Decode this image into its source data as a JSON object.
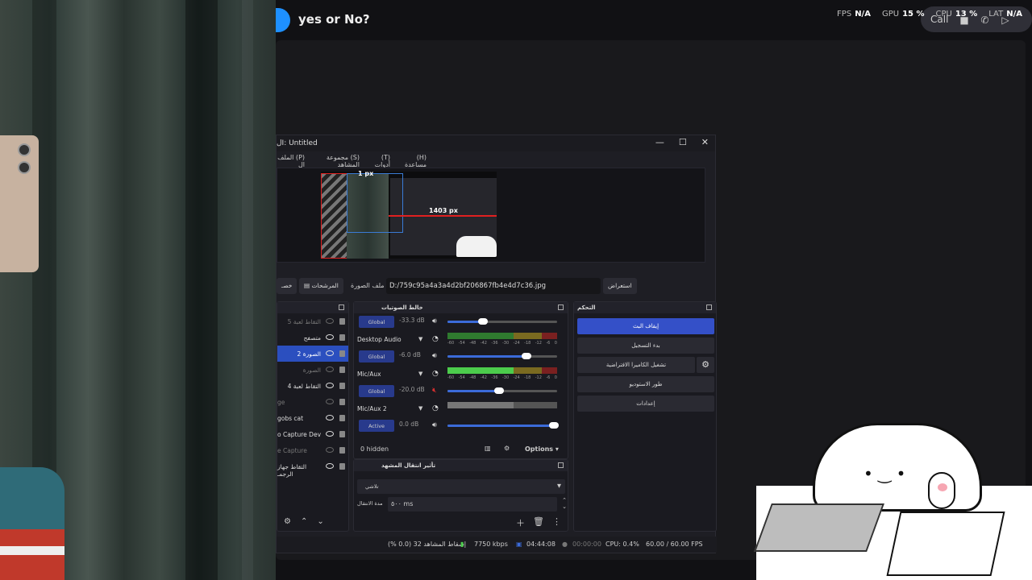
{
  "call": {
    "title": "yes or No?",
    "stats": [
      {
        "label": "FPS",
        "value": "N/A"
      },
      {
        "label": "GPU",
        "value": "15 %"
      },
      {
        "label": "CPU",
        "value": "13 %"
      },
      {
        "label": "LAT",
        "value": "N/A"
      }
    ],
    "call_label": "Call"
  },
  "obs": {
    "window_title": "لI: Untitled",
    "menu": [
      "(H) مساعدة",
      "(T) أدوات",
      "(S) مجموعة المشاهد",
      "(P) الملف ال"
    ],
    "preview": {
      "top_label": "1 px",
      "right_label": "1403 px"
    },
    "props": {
      "partial_btn": "خصـ",
      "filters_btn": "المرشحات",
      "image_file_label": "ملف الصورة",
      "path": "D:/759c95a4a3a4d2bf206867fb4e4d7c36.jpg",
      "browse_btn": "استعراض"
    },
    "sources": {
      "items": [
        {
          "name": "التقاط لعبة 5",
          "dim": true,
          "selected": false
        },
        {
          "name": "متصفح",
          "dim": false,
          "selected": false
        },
        {
          "name": "الصورة 2",
          "dim": false,
          "selected": true
        },
        {
          "name": "الصورة",
          "dim": true,
          "selected": false
        },
        {
          "name": "التقاط لعبة 4",
          "dim": false,
          "selected": false
        },
        {
          "name": "ge",
          "dim": true,
          "selected": false
        },
        {
          "name": "gobs cat",
          "dim": false,
          "selected": false
        },
        {
          "name": "o Capture Dev",
          "dim": false,
          "selected": false
        },
        {
          "name": "e Capture",
          "dim": true,
          "selected": false
        },
        {
          "name": "التقاط جهاز الرجمـ",
          "dim": false,
          "selected": false
        }
      ]
    },
    "mixer": {
      "title": "خالط الصوتيات",
      "channels": [
        {
          "mode": "Global",
          "db": "-33.3 dB",
          "name": "Desktop Audio",
          "level": 0.35,
          "muted": false
        },
        {
          "mode": "Global",
          "db": "-6.0 dB",
          "name": "Mic/Aux",
          "level": 0.75,
          "muted": false
        },
        {
          "mode": "Global",
          "db": "-20.0 dB",
          "name": "Mic/Aux 2",
          "level": 0.5,
          "muted": true
        },
        {
          "mode": "Active",
          "db": "0.0 dB",
          "name": "",
          "level": 1.0,
          "muted": false
        }
      ],
      "ticks": [
        "-60",
        "-54",
        "-48",
        "-42",
        "-36",
        "-30",
        "-24",
        "-18",
        "-12",
        "-6",
        "0"
      ],
      "hidden": "0 hidden",
      "options": "Options"
    },
    "transition": {
      "title": "تأثير انتقال المشهد",
      "selected": "تلاشي",
      "duration_label": "مدة الانتقال",
      "duration": "٥٠٠ ms"
    },
    "controls": {
      "title": "التحكم",
      "buttons": [
        "إيقاف البث",
        "بدء التسجيل",
        "تشغيل الكاميرا الافتراضية",
        "طور الاستوديو",
        "إعدادات"
      ]
    },
    "status": {
      "dropped": "إسقاط المشاهد 32 (0.0 %)",
      "bitrate": "7750 kbps",
      "stream_time": "04:44:08",
      "rec_time": "00:00:00",
      "cpu": "CPU: 0.4%",
      "fps": "60.00 / 60.00 FPS"
    }
  },
  "colors": {
    "accent": "#3450c8",
    "selected": "#2b4fbf",
    "meter_green": "#4ccc4c",
    "meter_yellow": "#c9a227",
    "meter_red": "#c0392b"
  }
}
